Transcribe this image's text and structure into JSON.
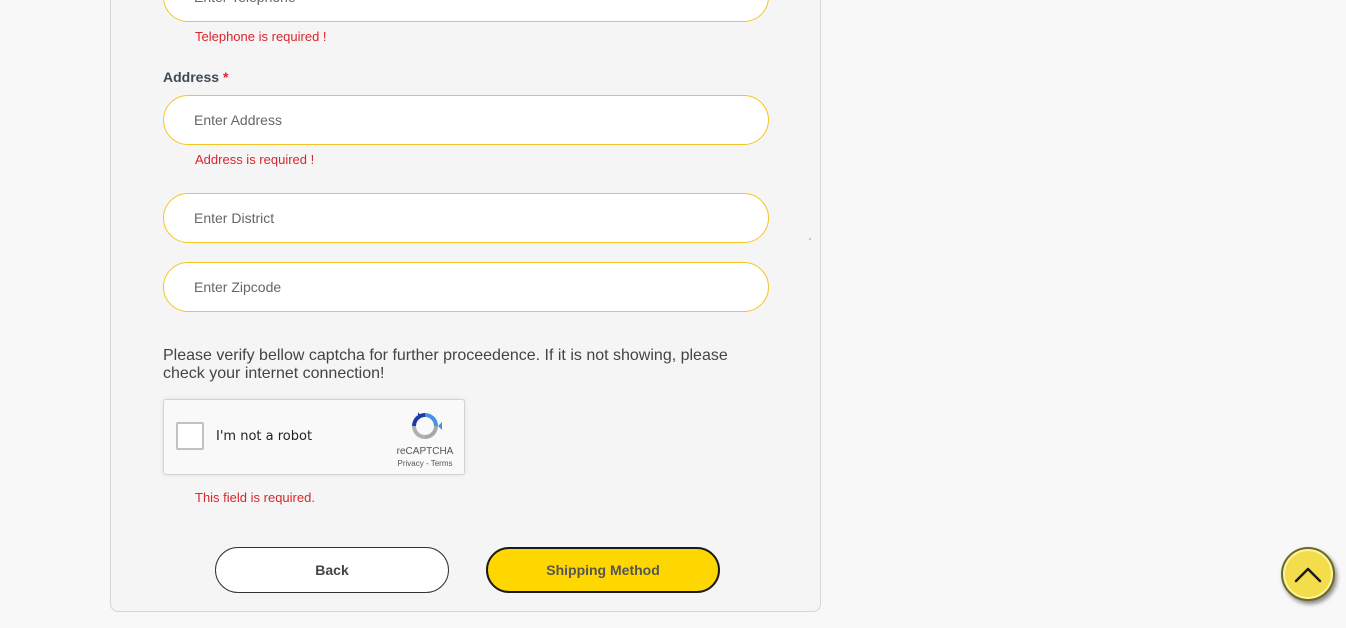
{
  "form": {
    "telephone": {
      "placeholder": "Enter Telephone",
      "error": "Telephone is required !"
    },
    "address": {
      "label": "Address",
      "required_mark": "*",
      "placeholder": "Enter Address",
      "error": "Address is required !"
    },
    "district": {
      "placeholder": "Enter District"
    },
    "zipcode": {
      "placeholder": "Enter Zipcode"
    }
  },
  "captcha": {
    "note": "Please verify bellow captcha for further proceedence. If it is not showing, please check your internet connection!",
    "checkbox_label": "I'm not a robot",
    "brand": "reCAPTCHA",
    "privacy": "Privacy",
    "separator": "-",
    "terms": "Terms",
    "error": "This field is required."
  },
  "buttons": {
    "back": "Back",
    "shipping": "Shipping Method"
  },
  "colors": {
    "accent_yellow": "#ffd700",
    "field_border": "#f3c623",
    "error_red": "#d8262c"
  },
  "icons": {
    "scroll_top": "chevron-up-icon",
    "recaptcha": "recaptcha-logo-icon"
  }
}
